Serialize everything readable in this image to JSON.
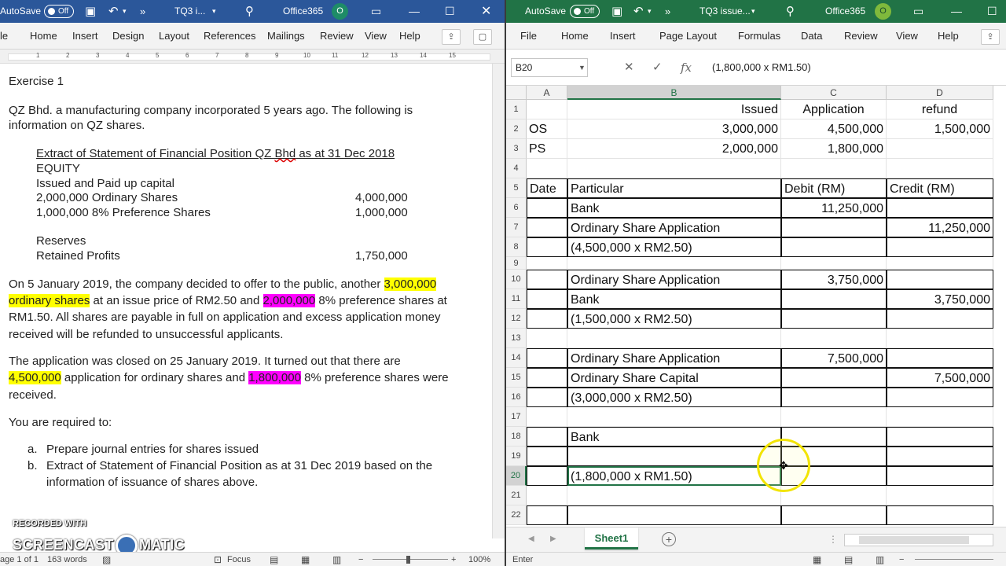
{
  "word": {
    "titlebar": {
      "autosave_label": "AutoSave",
      "autosave_state": "Off",
      "doc_name": "TQ3 i...",
      "expand": "»",
      "account": "Office365",
      "avatar": "O"
    },
    "menu": [
      "le",
      "Home",
      "Insert",
      "Design",
      "Layout",
      "References",
      "Mailings",
      "Review",
      "View",
      "Help"
    ],
    "ruler_numbers": [
      "1",
      "2",
      "3",
      "4",
      "5",
      "6",
      "7",
      "8",
      "9",
      "10",
      "11",
      "12",
      "13",
      "14",
      "15"
    ],
    "doc": {
      "heading": "Exercise 1",
      "intro_1": "QZ Bhd. a manufacturing company incorporated 5 years ago. The following is",
      "intro_2": "information on QZ shares.",
      "extract_title": "Extract of Statement of Financial Position QZ ",
      "extract_title_bhd": "Bhd",
      "extract_title_tail": " as at 31 Dec 2018",
      "equity": "EQUITY",
      "issued_paid": "Issued and Paid up capital",
      "ordinary_shares_label": "2,000,000 Ordinary Shares",
      "ordinary_shares_value": "4,000,000",
      "pref_shares_label": "1,000,000 8% Preference Shares",
      "pref_shares_value": "1,000,000",
      "reserves": "Reserves",
      "retained_label": "Retained Profits",
      "retained_value": "1,750,000",
      "p1_a": "On 5 January 2019, the company decided to offer to the public, another ",
      "p1_hl1": "3,000,000",
      "p1_hl2": "ordinary shares",
      "p1_b": " at an issue price of RM2.50 and ",
      "p1_hl3": "2,000,000",
      "p1_c": " 8% preference shares at",
      "p1_d": "RM1.50. All shares are payable in full on application and excess application money",
      "p1_e": "received will be refunded to unsuccessful applicants.",
      "p2_a": "The application was closed on 25 January 2019. It turned out that there are",
      "p2_hl1": "4,500,000",
      "p2_b": " application for ordinary shares and ",
      "p2_hl2": "1,800,000",
      "p2_c": " 8% preference shares were",
      "p2_d": "received.",
      "required": "You are required to:",
      "task_a_marker": "a.",
      "task_a": "Prepare journal entries for shares issued",
      "task_b_marker": "b.",
      "task_b_1": "Extract of Statement of Financial Position as at 31 Dec 2019 based on the",
      "task_b_2": "information of issuance of shares above."
    },
    "watermark": {
      "line1": "RECORDED WITH",
      "line2a": "SCREENCAST",
      "line2b": "MATIC"
    },
    "status": {
      "page": "age 1 of 1",
      "words": "163 words",
      "focus": "Focus",
      "zoom": "100%"
    }
  },
  "excel": {
    "titlebar": {
      "autosave_label": "AutoSave",
      "autosave_state": "Off",
      "doc_name": "TQ3 issue...",
      "expand": "»",
      "account": "Office365",
      "avatar": "O"
    },
    "menu": [
      "File",
      "Home",
      "Insert",
      "Page Layout",
      "Formulas",
      "Data",
      "Review",
      "View",
      "Help"
    ],
    "formula_bar": {
      "name_box": "B20",
      "formula": "(1,800,000 x RM1.50)"
    },
    "columns": [
      "A",
      "B",
      "C",
      "D"
    ],
    "rows": [
      "1",
      "2",
      "3",
      "4",
      "5",
      "6",
      "7",
      "8",
      "9",
      "10",
      "11",
      "12",
      "13",
      "14",
      "15",
      "16",
      "17",
      "18",
      "19",
      "20",
      "21",
      "22"
    ],
    "cells": {
      "B1": "Issued",
      "C1": "Application",
      "D1": "refund",
      "A2": "OS",
      "B2": "3,000,000",
      "C2": "4,500,000",
      "D2": "1,500,000",
      "A3": "PS",
      "B3": "2,000,000",
      "C3": "1,800,000",
      "A5": "Date",
      "B5": "Particular",
      "C5": "Debit (RM)",
      "D5": "Credit (RM)",
      "B6": "Bank",
      "C6": "11,250,000",
      "B7": "Ordinary Share Application",
      "D7": "11,250,000",
      "B8": "(4,500,000 x RM2.50)",
      "B10": "Ordinary Share Application",
      "C10": "3,750,000",
      "B11": "Bank",
      "D11": "3,750,000",
      "B12": "(1,500,000 x RM2.50)",
      "B14": "Ordinary Share Application",
      "C14": "7,500,000",
      "B15": "Ordinary Share Capital",
      "D15": "7,500,000",
      "B16": "(3,000,000 x RM2.50)",
      "B18": "Bank",
      "B20": "(1,800,000 x RM1.50)"
    },
    "sheet_tab": "Sheet1",
    "status": "Enter"
  }
}
